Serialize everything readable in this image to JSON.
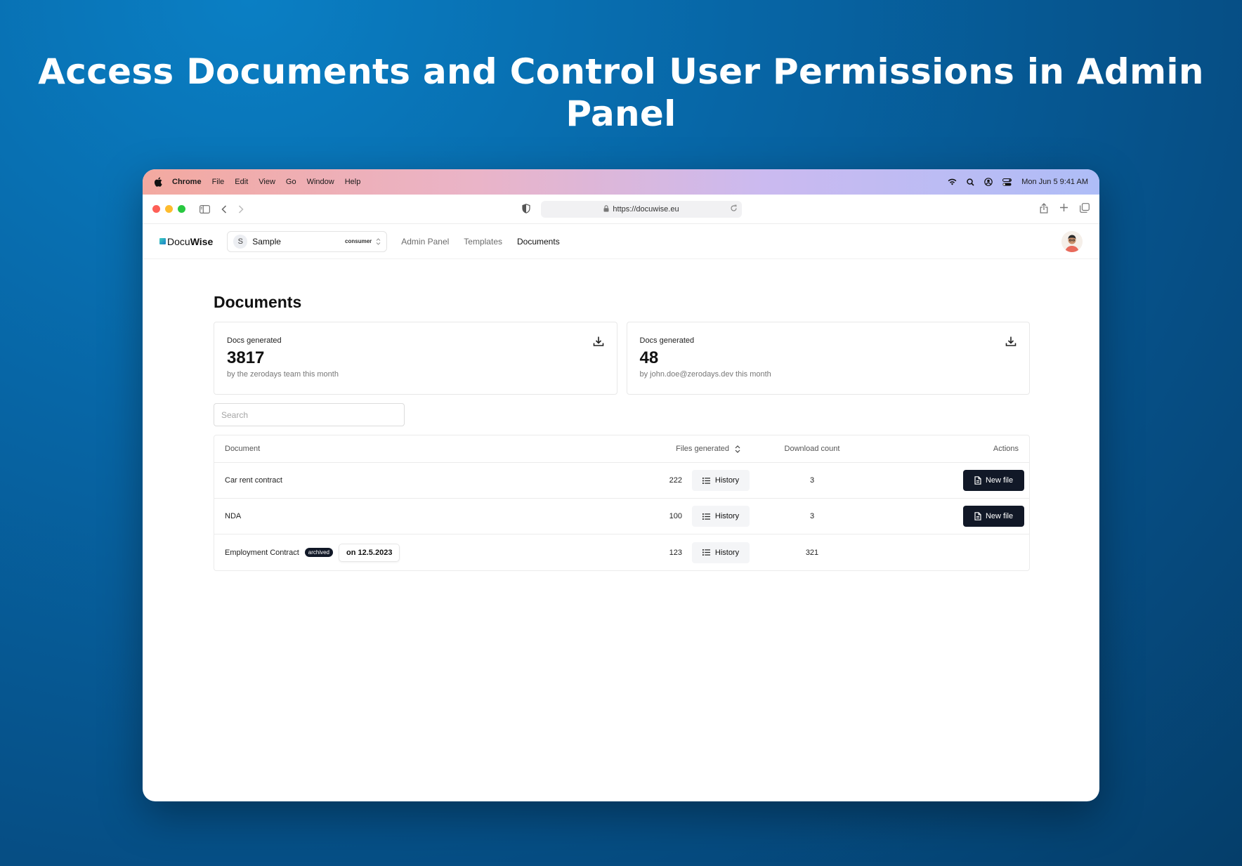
{
  "headline": "Access Documents and Control User Permissions in Admin Panel",
  "menubar": {
    "items": [
      "Chrome",
      "File",
      "Edit",
      "View",
      "Go",
      "Window",
      "Help"
    ],
    "clock": "Mon Jun 5  9:41 AM"
  },
  "browser": {
    "url": "https://docuwise.eu"
  },
  "app": {
    "logo_a": "Docu",
    "logo_b": "Wise",
    "org": {
      "initial": "S",
      "name": "Sample",
      "role": "consumer"
    },
    "nav": [
      "Admin Panel",
      "Templates",
      "Documents"
    ],
    "active_nav": "Documents"
  },
  "page": {
    "title": "Documents",
    "stats": [
      {
        "label": "Docs generated",
        "value": "3817",
        "sub": "by the zerodays team this month"
      },
      {
        "label": "Docs generated",
        "value": "48",
        "sub": "by john.doe@zerodays.dev this month"
      }
    ],
    "search_placeholder": "Search"
  },
  "table": {
    "headers": {
      "document": "Document",
      "files": "Files generated",
      "downloads": "Download count",
      "actions": "Actions"
    },
    "history_label": "History",
    "new_file_label": "New file",
    "rows": [
      {
        "name": "Car rent contract",
        "files": "222",
        "downloads": "3",
        "archived": false
      },
      {
        "name": "NDA",
        "files": "100",
        "downloads": "3",
        "archived": false
      },
      {
        "name": "Employment Contract",
        "files": "123",
        "downloads": "321",
        "archived": true,
        "badge": "archived",
        "archived_on": "on 12.5.2023"
      }
    ]
  }
}
